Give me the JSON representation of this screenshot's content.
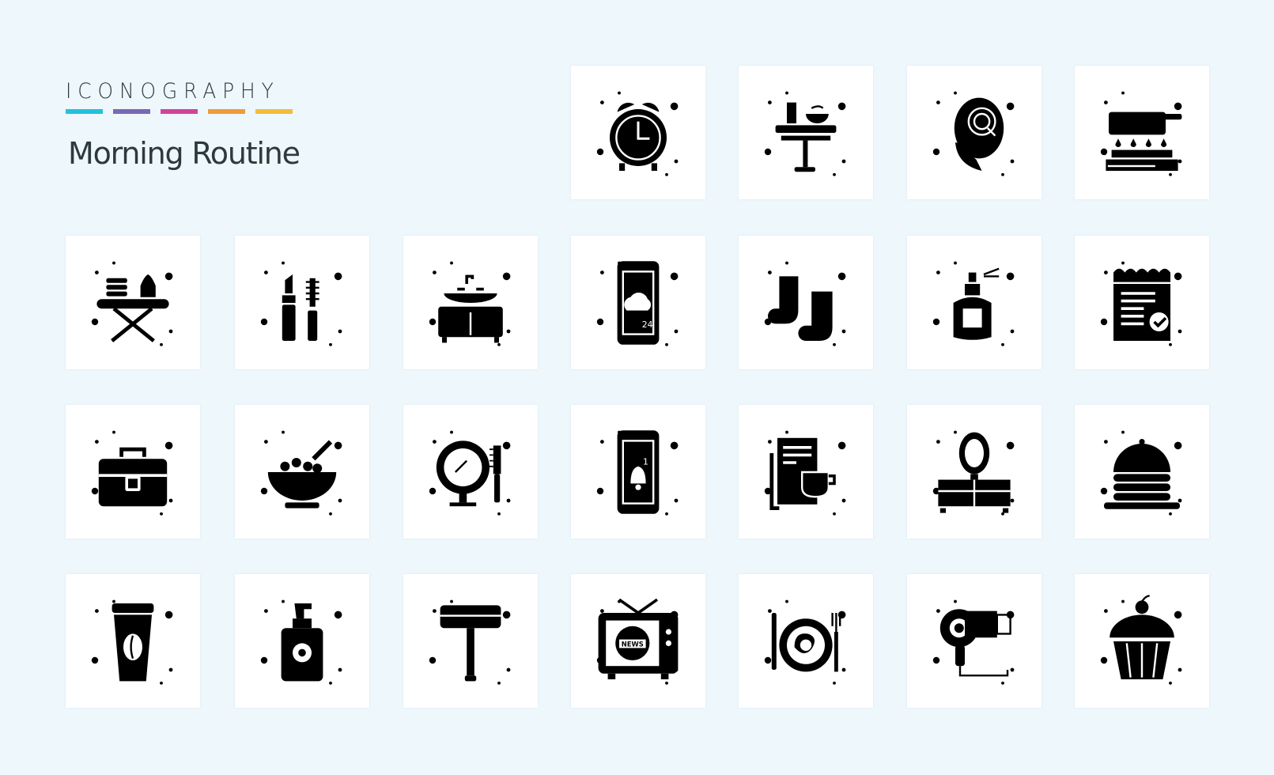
{
  "brand": {
    "label": "ICONOGRAPHY",
    "bar_colors": [
      "#25c1dc",
      "#7b68b5",
      "#d2449b",
      "#f29a3a",
      "#f2bd3a"
    ]
  },
  "title": "Morning Routine",
  "tiles": [
    {
      "icon": "alarm-clock-icon"
    },
    {
      "icon": "breakfast-table-icon"
    },
    {
      "icon": "coffee-croissant-icon"
    },
    {
      "icon": "pan-stove-icon"
    },
    {
      "icon": "ironing-board-icon"
    },
    {
      "icon": "lipstick-mascara-icon"
    },
    {
      "icon": "bathroom-sink-icon"
    },
    {
      "icon": "weather-phone-icon",
      "text": "24"
    },
    {
      "icon": "socks-icon"
    },
    {
      "icon": "perfume-icon"
    },
    {
      "icon": "checklist-notepad-icon"
    },
    {
      "icon": "briefcase-icon"
    },
    {
      "icon": "cereal-bowl-icon"
    },
    {
      "icon": "mirror-comb-icon"
    },
    {
      "icon": "phone-notification-icon",
      "text": "1"
    },
    {
      "icon": "newspaper-coffee-icon"
    },
    {
      "icon": "dressing-table-icon"
    },
    {
      "icon": "pancakes-icon"
    },
    {
      "icon": "coffee-cup-icon"
    },
    {
      "icon": "lotion-bottle-icon"
    },
    {
      "icon": "razor-icon"
    },
    {
      "icon": "news-tv-icon",
      "text": "NEWS"
    },
    {
      "icon": "breakfast-plate-icon"
    },
    {
      "icon": "hair-dryer-icon"
    },
    {
      "icon": "cupcake-icon"
    }
  ]
}
